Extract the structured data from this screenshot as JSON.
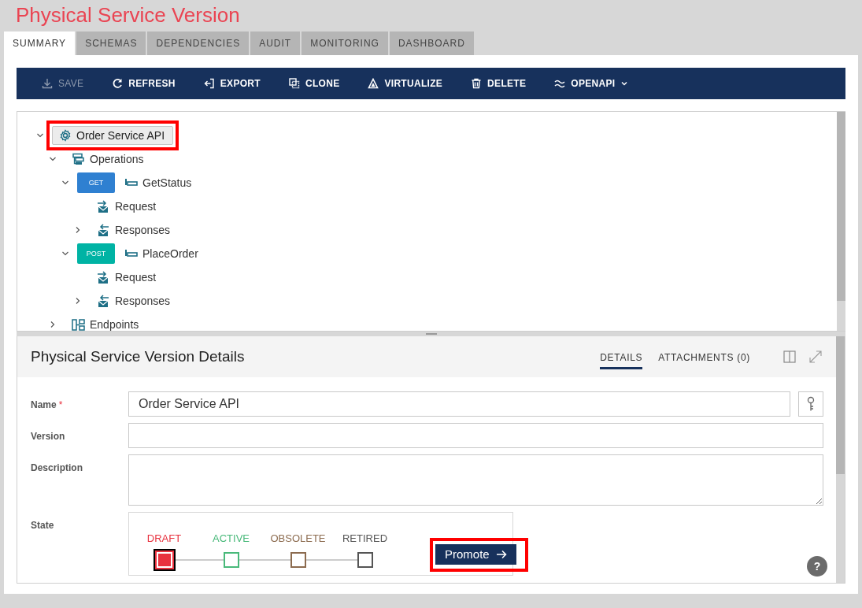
{
  "page_title": "Physical Service Version",
  "tabs": [
    {
      "label": "SUMMARY",
      "selected": true
    },
    {
      "label": "SCHEMAS",
      "selected": false
    },
    {
      "label": "DEPENDENCIES",
      "selected": false
    },
    {
      "label": "AUDIT",
      "selected": false
    },
    {
      "label": "MONITORING",
      "selected": false
    },
    {
      "label": "DASHBOARD",
      "selected": false
    }
  ],
  "toolbar": [
    {
      "label": "SAVE",
      "kind": "download",
      "disabled": true
    },
    {
      "label": "REFRESH",
      "kind": "refresh",
      "disabled": false
    },
    {
      "label": "EXPORT",
      "kind": "export",
      "disabled": false
    },
    {
      "label": "CLONE",
      "kind": "clone",
      "disabled": false
    },
    {
      "label": "VIRTUALIZE",
      "kind": "virtualize",
      "disabled": false
    },
    {
      "label": "DELETE",
      "kind": "trash",
      "disabled": false
    },
    {
      "label": "OPENAPI",
      "kind": "wave",
      "disabled": false,
      "dropdown": true
    }
  ],
  "tree": [
    {
      "kind": "service",
      "label": "Order Service API",
      "expanded": true,
      "highlighted": true,
      "children": [
        {
          "kind": "operations",
          "label": "Operations",
          "expanded": true,
          "children": [
            {
              "kind": "operation",
              "method": "GET",
              "color": "#2f80d1",
              "label": "GetStatus",
              "expanded": true,
              "children": [
                {
                  "kind": "request",
                  "label": "Request"
                },
                {
                  "kind": "responses",
                  "label": "Responses",
                  "expanded": false
                }
              ]
            },
            {
              "kind": "operation",
              "method": "POST",
              "color": "#00b3a4",
              "label": "PlaceOrder",
              "expanded": true,
              "children": [
                {
                  "kind": "request",
                  "label": "Request"
                },
                {
                  "kind": "responses",
                  "label": "Responses",
                  "expanded": false
                }
              ]
            }
          ]
        },
        {
          "kind": "endpoints",
          "label": "Endpoints",
          "expanded": false
        }
      ]
    }
  ],
  "details": {
    "title": "Physical Service Version Details",
    "tabs": [
      {
        "label": "DETAILS",
        "selected": true
      },
      {
        "label": "ATTACHMENTS (0)",
        "selected": false
      }
    ],
    "fields": [
      {
        "kind": "text",
        "label": "Name",
        "required_mark": "*",
        "value": "Order Service API",
        "key_button": true
      },
      {
        "kind": "text",
        "label": "Version"
      },
      {
        "kind": "textarea",
        "label": "Description"
      },
      {
        "kind": "state",
        "label": "State",
        "stages": [
          {
            "label": "DRAFT",
            "color": "#e8323f",
            "selected": true
          },
          {
            "label": "ACTIVE",
            "color": "#49b97a",
            "selected": false
          },
          {
            "label": "OBSOLETE",
            "color": "#8c6b4f",
            "selected": false
          },
          {
            "label": "RETIRED",
            "color": "#555555",
            "selected": false
          }
        ],
        "action": {
          "label": "Promote",
          "highlighted": true
        }
      }
    ],
    "help": "?"
  }
}
